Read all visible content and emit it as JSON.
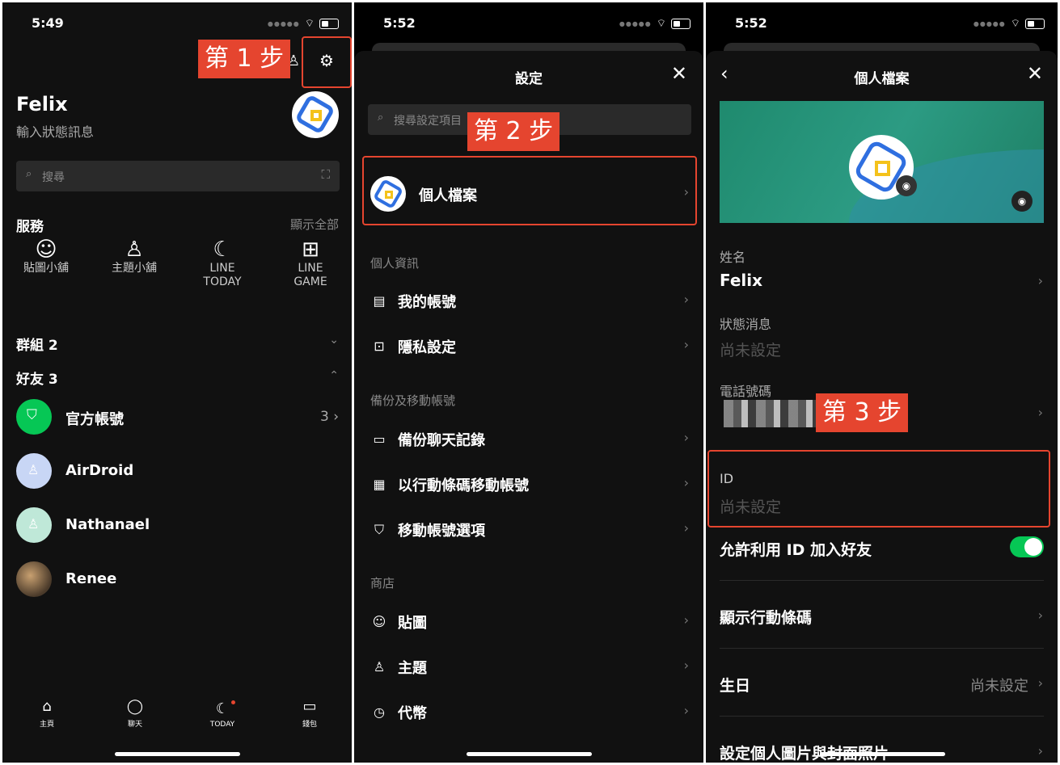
{
  "p1": {
    "time": "5:49",
    "name": "Felix",
    "status_placeholder": "輸入狀態訊息",
    "search_placeholder": "搜尋",
    "services_title": "服務",
    "show_all": "顯示全部",
    "services": [
      {
        "icon": "☺",
        "label": "貼圖小舖"
      },
      {
        "icon": "♙",
        "label": "主題小舖"
      },
      {
        "icon": "☾",
        "label": "LINE\nTODAY"
      },
      {
        "icon": "⊞",
        "label": "LINE\nGAME"
      }
    ],
    "groups": "群組 2",
    "friends": "好友 3",
    "official": "官方帳號",
    "official_count": "3",
    "friend_list": [
      "AirDroid",
      "Nathanael",
      "Renee"
    ],
    "nav": [
      "主頁",
      "聊天",
      "TODAY",
      "錢包"
    ],
    "callout": "第 1 步"
  },
  "p2": {
    "time": "5:52",
    "title": "設定",
    "search_placeholder": "搜尋設定項目",
    "profile": "個人檔案",
    "sec_personal": "個人資訊",
    "my_account": "我的帳號",
    "privacy": "隱私設定",
    "sec_backup": "備份及移動帳號",
    "backup_chat": "備份聊天記錄",
    "qr_move": "以行動條碼移動帳號",
    "move_options": "移動帳號選項",
    "sec_shop": "商店",
    "stickers": "貼圖",
    "themes": "主題",
    "coins": "代幣",
    "callout": "第 2 步"
  },
  "p3": {
    "time": "5:52",
    "title": "個人檔案",
    "name_label": "姓名",
    "name_value": "Felix",
    "status_label": "狀態消息",
    "status_value": "尚未設定",
    "phone_label": "電話號碼",
    "id_label": "ID",
    "id_value": "尚未設定",
    "allow_id": "允許利用 ID 加入好友",
    "show_qr": "顯示行動條碼",
    "birthday": "生日",
    "birthday_value": "尚未設定",
    "set_photo": "設定個人圖片與封面照片",
    "callout": "第 3 步"
  }
}
